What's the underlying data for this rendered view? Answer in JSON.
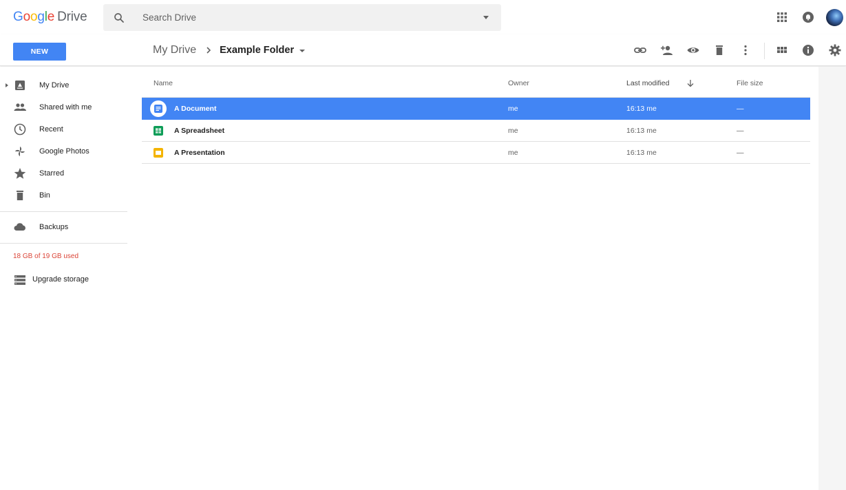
{
  "header": {
    "logo_letters": [
      "G",
      "o",
      "o",
      "g",
      "l",
      "e"
    ],
    "logo_word": "Drive",
    "search_placeholder": "Search Drive"
  },
  "toolbar": {
    "new_label": "NEW",
    "breadcrumb": {
      "root": "My Drive",
      "current": "Example Folder"
    },
    "actions": [
      "link-icon",
      "share-person-icon",
      "preview-eye-icon",
      "delete-bin-icon",
      "more-vert-icon",
      "grid-view-icon",
      "info-icon",
      "settings-gear-icon"
    ]
  },
  "sidebar": {
    "items": [
      {
        "label": "My Drive",
        "icon": "drive-icon"
      },
      {
        "label": "Shared with me",
        "icon": "people-icon"
      },
      {
        "label": "Recent",
        "icon": "clock-icon"
      },
      {
        "label": "Google Photos",
        "icon": "pinwheel-icon"
      },
      {
        "label": "Starred",
        "icon": "star-icon"
      },
      {
        "label": "Bin",
        "icon": "bin-icon"
      },
      {
        "label": "Backups",
        "icon": "cloud-icon"
      }
    ],
    "storage_text": "18 GB of 19 GB used",
    "upgrade_label": "Upgrade storage"
  },
  "list": {
    "columns": {
      "name": "Name",
      "owner": "Owner",
      "modified": "Last modified",
      "size": "File size"
    },
    "rows": [
      {
        "name": "A Document",
        "owner": "me",
        "modified": "16:13 me",
        "size": "—",
        "type": "document",
        "selected": true
      },
      {
        "name": "A Spreadsheet",
        "owner": "me",
        "modified": "16:13 me",
        "size": "—",
        "type": "spreadsheet",
        "selected": false
      },
      {
        "name": "A Presentation",
        "owner": "me",
        "modified": "16:13 me",
        "size": "—",
        "type": "presentation",
        "selected": false
      }
    ]
  },
  "colors": {
    "accent": "#4285f4",
    "storage_warning": "#db4437",
    "doc_blue": "#4285f4",
    "sheet_green": "#0f9d58",
    "slides_yellow": "#f4b400"
  }
}
